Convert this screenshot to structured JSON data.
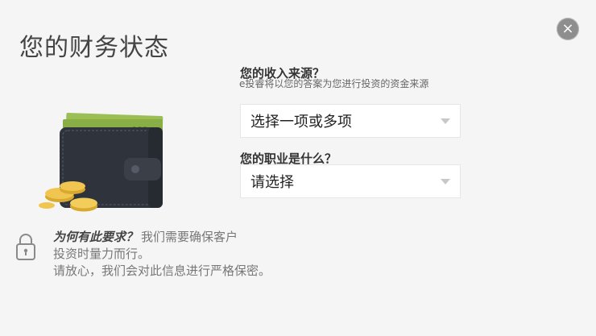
{
  "dialog": {
    "title": "您的财务状态",
    "close_icon": "×"
  },
  "income": {
    "label": "您的收入来源？",
    "description": "e投睿将以您的答案为您进行投资的资金来源",
    "select_value": "选择一项或多项"
  },
  "occupation": {
    "label": "您的职业是什么？",
    "select_value": "请选择"
  },
  "notice": {
    "title": "为何有此要求？",
    "line1": "我们需要确保客户",
    "line2": "投资时量力而行。",
    "line3": "请放心，我们会对此信息进行严格保密。"
  },
  "icons": {
    "close": "close-icon",
    "wallet": "wallet-illustration",
    "lock": "lock-icon",
    "caret": "chevron-down-icon"
  },
  "colors": {
    "background": "#f5f5f5",
    "close_button": "#8e8e8e",
    "wallet_body": "#2f333c",
    "money": "#8fb04a",
    "coin": "#e0b43a"
  }
}
